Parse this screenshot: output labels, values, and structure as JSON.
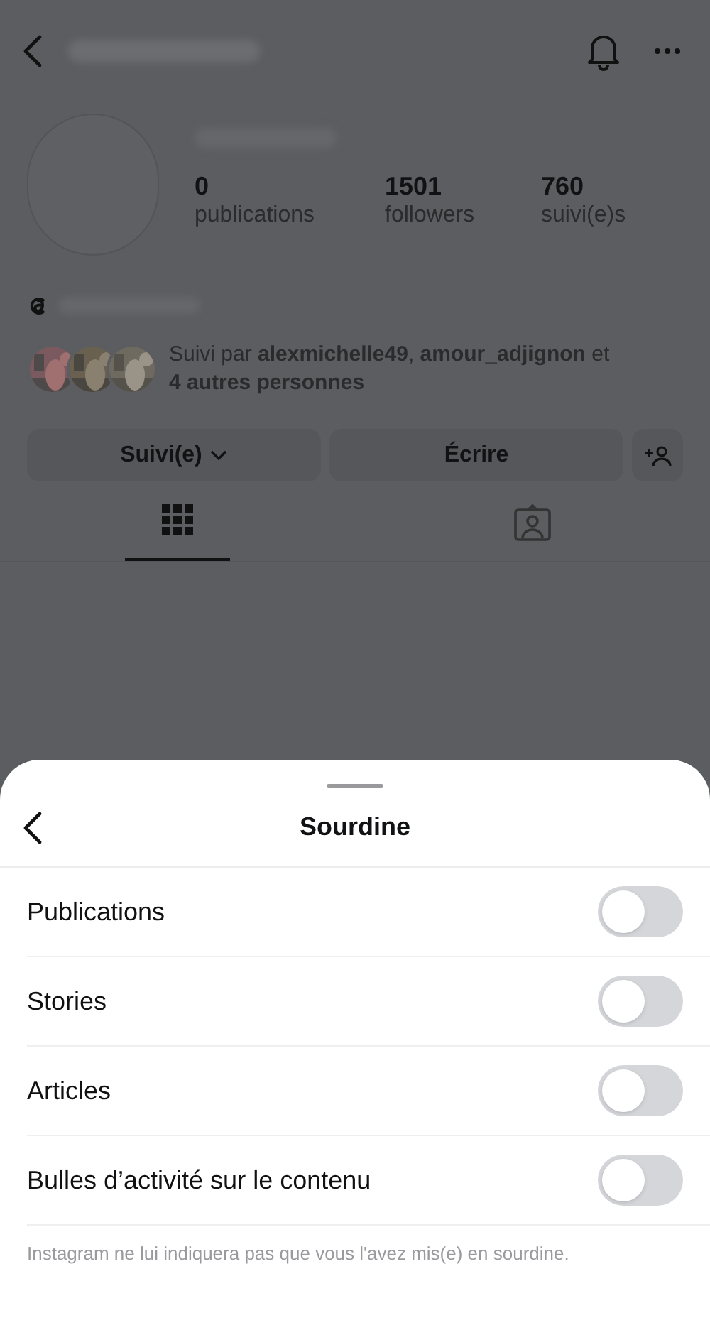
{
  "profile": {
    "stats": [
      {
        "value": "0",
        "label": "publications"
      },
      {
        "value": "1501",
        "label": "followers"
      },
      {
        "value": "760",
        "label": "suivi(e)s"
      }
    ],
    "followed_by": "Suivi par **alexmichelle49**, **amour_adjignon** et **4 autres personnes**",
    "buttons": [
      {
        "label": "Suivi(e)",
        "kind": "dropdown"
      },
      {
        "label": "Écrire",
        "kind": "plain"
      },
      {
        "kind": "add-person"
      }
    ],
    "tabs": [
      {
        "kind": "grid",
        "selected": true
      },
      {
        "kind": "tagged",
        "selected": false
      }
    ]
  },
  "sheet": {
    "title": "Sourdine",
    "options": [
      {
        "label": "Publications",
        "on": false
      },
      {
        "label": "Stories",
        "on": false
      },
      {
        "label": "Articles",
        "on": false
      },
      {
        "label": "Bulles d’activité sur le contenu",
        "on": false
      }
    ],
    "footnote": "Instagram ne lui indiquera pas que vous l'avez mis(e) en sourdine."
  }
}
